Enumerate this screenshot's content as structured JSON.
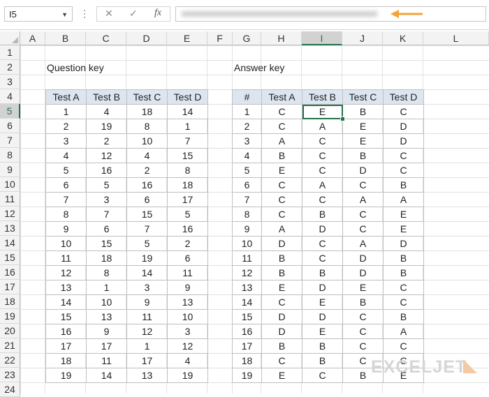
{
  "name_box": "I5",
  "formula_buttons": {
    "cancel": "✕",
    "enter": "✓",
    "fx": "fx"
  },
  "columns": [
    "A",
    "B",
    "C",
    "D",
    "E",
    "F",
    "G",
    "H",
    "I",
    "J",
    "K",
    "L"
  ],
  "selected_column": "I",
  "rows": [
    "1",
    "2",
    "3",
    "4",
    "5",
    "6",
    "7",
    "8",
    "9",
    "10",
    "11",
    "12",
    "13",
    "14",
    "15",
    "16",
    "17",
    "18",
    "19",
    "20",
    "21",
    "22",
    "23",
    "24"
  ],
  "selected_row": "5",
  "question_key": {
    "title": "Question key",
    "headers": [
      "Test A",
      "Test B",
      "Test C",
      "Test D"
    ],
    "rows": [
      [
        "1",
        "4",
        "18",
        "14"
      ],
      [
        "2",
        "19",
        "8",
        "1"
      ],
      [
        "3",
        "2",
        "10",
        "7"
      ],
      [
        "4",
        "12",
        "4",
        "15"
      ],
      [
        "5",
        "16",
        "2",
        "8"
      ],
      [
        "6",
        "5",
        "16",
        "18"
      ],
      [
        "7",
        "3",
        "6",
        "17"
      ],
      [
        "8",
        "7",
        "15",
        "5"
      ],
      [
        "9",
        "6",
        "7",
        "16"
      ],
      [
        "10",
        "15",
        "5",
        "2"
      ],
      [
        "11",
        "18",
        "19",
        "6"
      ],
      [
        "12",
        "8",
        "14",
        "11"
      ],
      [
        "13",
        "1",
        "3",
        "9"
      ],
      [
        "14",
        "10",
        "9",
        "13"
      ],
      [
        "15",
        "13",
        "11",
        "10"
      ],
      [
        "16",
        "9",
        "12",
        "3"
      ],
      [
        "17",
        "17",
        "1",
        "12"
      ],
      [
        "18",
        "11",
        "17",
        "4"
      ],
      [
        "19",
        "14",
        "13",
        "19"
      ]
    ]
  },
  "answer_key": {
    "title": "Answer key",
    "headers": [
      "#",
      "Test A",
      "Test B",
      "Test C",
      "Test D"
    ],
    "rows": [
      [
        "1",
        "C",
        "E",
        "B",
        "C"
      ],
      [
        "2",
        "C",
        "A",
        "E",
        "D"
      ],
      [
        "3",
        "A",
        "C",
        "E",
        "D"
      ],
      [
        "4",
        "B",
        "C",
        "B",
        "C"
      ],
      [
        "5",
        "E",
        "C",
        "D",
        "C"
      ],
      [
        "6",
        "C",
        "A",
        "C",
        "B"
      ],
      [
        "7",
        "C",
        "C",
        "A",
        "A"
      ],
      [
        "8",
        "C",
        "B",
        "C",
        "E"
      ],
      [
        "9",
        "A",
        "D",
        "C",
        "E"
      ],
      [
        "10",
        "D",
        "C",
        "A",
        "D"
      ],
      [
        "11",
        "B",
        "C",
        "D",
        "B"
      ],
      [
        "12",
        "B",
        "B",
        "D",
        "B"
      ],
      [
        "13",
        "E",
        "D",
        "E",
        "C"
      ],
      [
        "14",
        "C",
        "E",
        "B",
        "C"
      ],
      [
        "15",
        "D",
        "D",
        "C",
        "B"
      ],
      [
        "16",
        "D",
        "E",
        "C",
        "A"
      ],
      [
        "17",
        "B",
        "B",
        "C",
        "C"
      ],
      [
        "18",
        "C",
        "B",
        "C",
        "C"
      ],
      [
        "19",
        "E",
        "C",
        "B",
        "E"
      ]
    ]
  },
  "watermark": "EXCELJET",
  "colors": {
    "accent": "#217346",
    "header_fill": "#dde6f0",
    "arrow": "#f2a33a"
  }
}
